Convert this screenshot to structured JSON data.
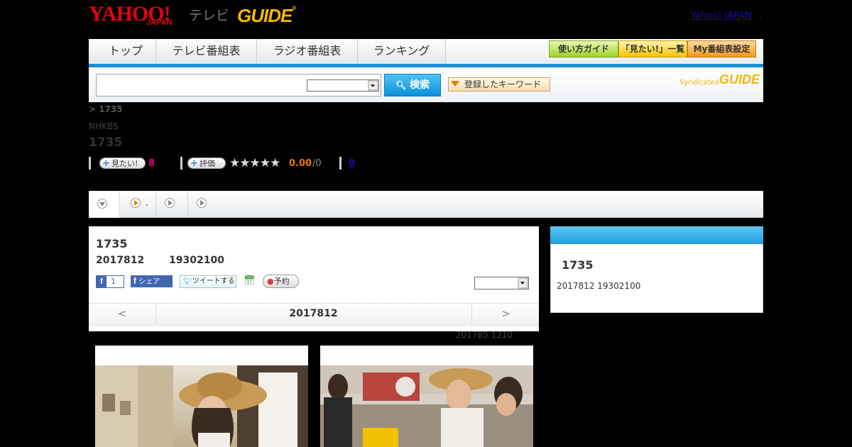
{
  "header": {
    "logo_yahoo": "YAHOO!",
    "logo_japan": "JAPAN",
    "logo_tv": "テレビ",
    "logo_g": "GUIDE",
    "top_link": "Yahoo! JAPAN",
    "top_link_sep": ",",
    "small_dot": ","
  },
  "nav": {
    "tabs": [
      "トップ",
      "テレビ番組表",
      "ラジオ番組表",
      "ランキング"
    ],
    "utility": [
      "使い方ガイド",
      "「見たい!」一覧",
      "My番組表設定"
    ]
  },
  "search": {
    "button_label": "検索",
    "keyword_button": "登録したキーワード",
    "syndicated_text": "Syndicated",
    "syndicated_logo": "GUIDE"
  },
  "breadcrumb": "> 1735",
  "program": {
    "channel": "NHKBS",
    "title": "1735",
    "want_label": "見たい!",
    "want_count": "8",
    "rate_label": "評価",
    "stars": "★★★★★",
    "score": "0.00",
    "score_den": "/0",
    "link_count": "0"
  },
  "tabs": {
    "second_label": "."
  },
  "detail": {
    "title": "1735",
    "date": "2017812",
    "time": "19302100",
    "fb_like_count": "1",
    "fb_share": "シェア",
    "tweet": "ツイートする",
    "reserve": "予約",
    "pager_prev": "<",
    "pager_date": "2017812",
    "pager_next": ">",
    "footnote": "201785  1210"
  },
  "side": {
    "title": "1735",
    "info": "2017812  19302100"
  },
  "colors": {
    "brand_red": "#e60012",
    "guide_yellow": "#f5b800",
    "nav_blue": "#1a8fd6",
    "want_pink": "#e4007f",
    "score_orange": "#e67e00"
  }
}
